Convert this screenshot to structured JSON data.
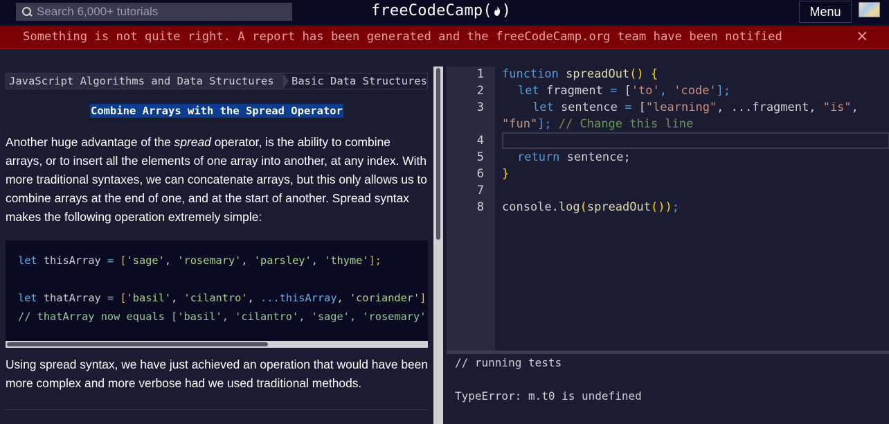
{
  "nav": {
    "search_placeholder": "Search 6,000+ tutorials",
    "logo_left": "freeCodeCamp(",
    "logo_right": ")",
    "menu_label": "Menu"
  },
  "banner": {
    "message": "Something is not quite right. A report has been generated and the freeCodeCamp.org team have been notified",
    "close": "×"
  },
  "breadcrumb": {
    "superblock": "JavaScript Algorithms and Data Structures",
    "block": "Basic Data Structures"
  },
  "challenge": {
    "title": "Combine Arrays with the Spread Operator",
    "desc_p1_before": "Another huge advantage of the ",
    "desc_p1_em": "spread",
    "desc_p1_after": " operator, is the ability to combine arrays, or to insert all the elements of one array into another, at any index. With more traditional syntaxes, we can concatenate arrays, but this only allows us to combine arrays at the end of one, and at the start of another. Spread syntax makes the following operation extremely simple:",
    "desc_p2": "Using spread syntax, we have just achieved an operation that would have been more complex and more verbose had we used traditional methods."
  },
  "example_code": {
    "l1_kw": "let",
    "l1_var": " thisArray ",
    "l1_eq": "= ",
    "l1_ob": "[",
    "l1_s1": "'sage'",
    "l1_s2": "'rosemary'",
    "l1_s3": "'parsley'",
    "l1_s4": "'thyme'",
    "l1_cb": "];",
    "l2_kw": "let",
    "l2_var": " thatArray ",
    "l2_eq": "= ",
    "l2_ob": "[",
    "l2_s1": "'basil'",
    "l2_s2": "'cilantro'",
    "l2_spread": "...thisArray",
    "l2_s3": "'coriander'",
    "l2_cb": "];",
    "l3_comment": "// thatArray now equals ['basil', 'cilantro', 'sage', 'rosemary', 'parsley', 'thyme', 'coriander']"
  },
  "editor": {
    "line_numbers": [
      "1",
      "2",
      "3",
      "",
      "4",
      "5",
      "6",
      "7",
      "8"
    ],
    "l1_kw": "function",
    "l1_name": " spreadOut",
    "l1_paren": "()",
    "l1_brace": " {",
    "l2_kw": "let",
    "l2_var": " fragment ",
    "l2_eq": "= ",
    "l2_ob": "[",
    "l2_s1": "'to'",
    "l2_comma": ", ",
    "l2_s2": "'code'",
    "l2_cb": "];",
    "l3_kw": "let",
    "l3_var": " sentence ",
    "l3_eq": "= ",
    "l3_ob": "[",
    "l3_s1": "\"learning\"",
    "l3_sep1": ", ...fragment, ",
    "l3_s2": "\"is\"",
    "l3_sep2": ",",
    "l3b_s3": "\"fun\"",
    "l3b_cb": "];",
    "l3b_comment": " // Change this line",
    "l5_kw": "return",
    "l5_rest": " sentence;",
    "l6_brace": "}",
    "l8_obj": "console",
    "l8_dot": ".log",
    "l8_op": "(",
    "l8_fn": "spreadOut",
    "l8_inner": "()",
    "l8_cp": ")",
    "l8_semi": ";"
  },
  "console": {
    "line1": "// running tests",
    "line2": "TypeError: m.t0 is undefined"
  }
}
